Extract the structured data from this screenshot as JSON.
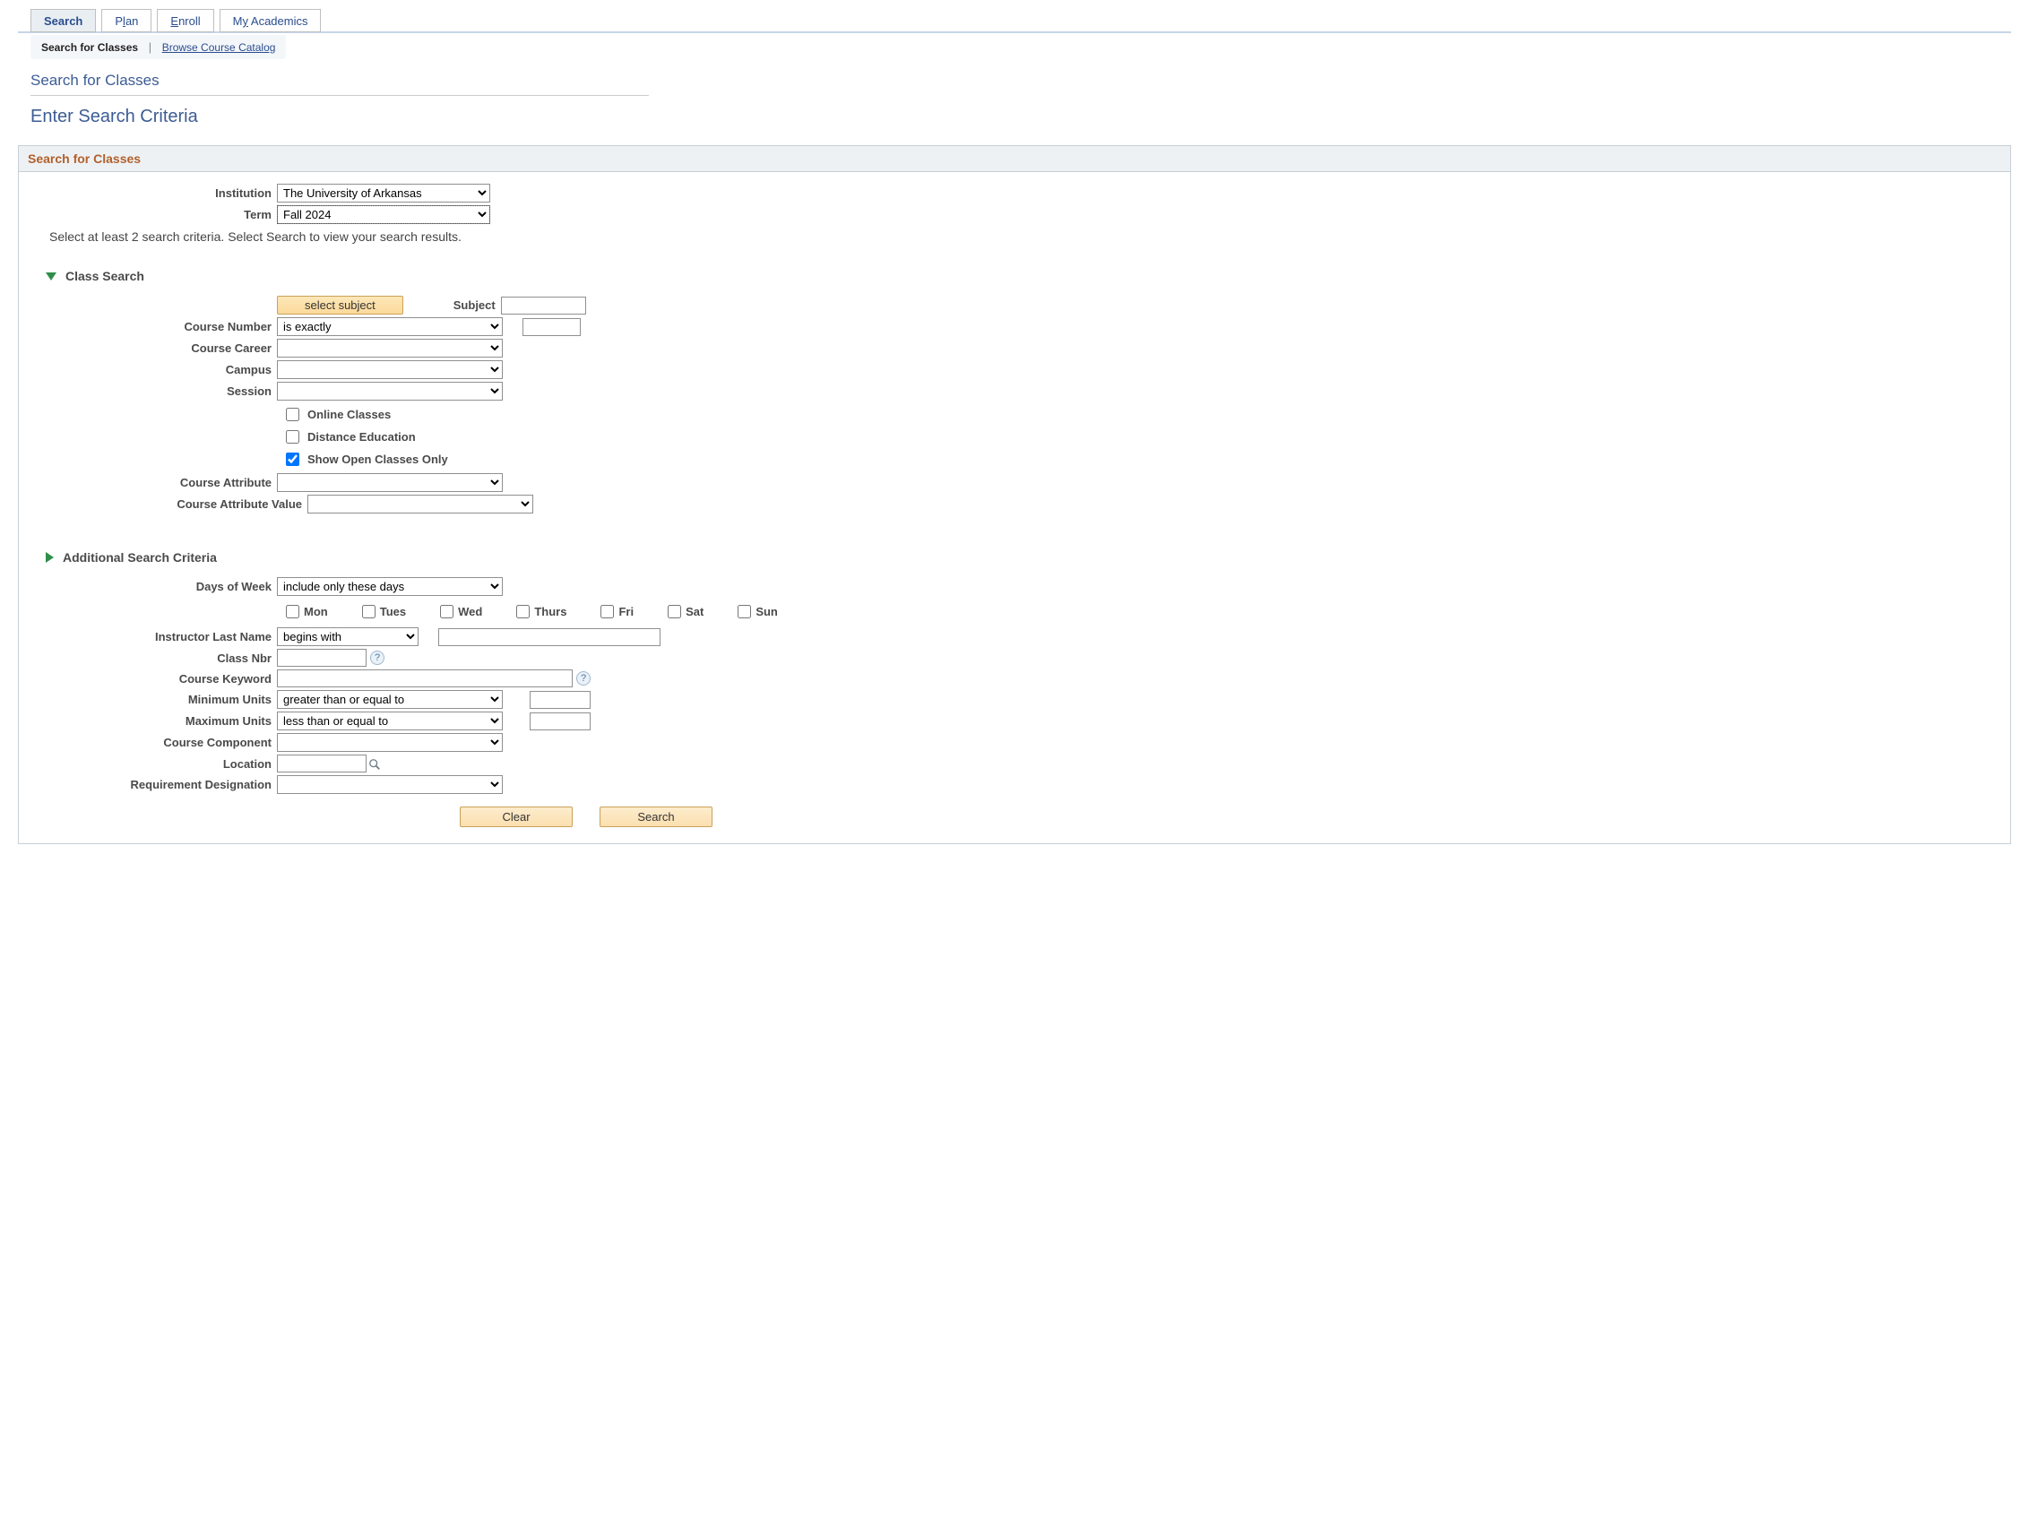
{
  "tabs": {
    "search": "Search",
    "plan_pre": "P",
    "plan_ul": "l",
    "plan_post": "an",
    "enroll_pre": "",
    "enroll_ul": "E",
    "enroll_post": "nroll",
    "myacad_pre": "M",
    "myacad_ul": "y",
    "myacad_post": " Academics"
  },
  "subtabs": {
    "search_for_classes": "Search for Classes",
    "browse": "Browse Course Catalog"
  },
  "titles": {
    "page": "Search for Classes",
    "sub": "Enter Search Criteria",
    "panel": "Search for Classes"
  },
  "labels": {
    "institution": "Institution",
    "term": "Term",
    "instructions": "Select at least 2 search criteria. Select Search to view your search results.",
    "class_search": "Class Search",
    "select_subject_btn": "select subject",
    "subject": "Subject",
    "course_number": "Course Number",
    "course_career": "Course Career",
    "campus": "Campus",
    "session": "Session",
    "online_classes": "Online Classes",
    "distance_ed": "Distance Education",
    "open_only": "Show Open Classes Only",
    "course_attr": "Course Attribute",
    "course_attr_val": "Course Attribute Value",
    "additional": "Additional Search Criteria",
    "days_of_week": "Days of Week",
    "mon": "Mon",
    "tue": "Tues",
    "wed": "Wed",
    "thu": "Thurs",
    "fri": "Fri",
    "sat": "Sat",
    "sun": "Sun",
    "instr_last": "Instructor Last Name",
    "class_nbr": "Class Nbr",
    "course_keyword": "Course Keyword",
    "min_units": "Minimum Units",
    "max_units": "Maximum Units",
    "course_comp": "Course Component",
    "location": "Location",
    "req_desig": "Requirement Designation",
    "clear": "Clear",
    "search": "Search"
  },
  "values": {
    "institution": "The University of Arkansas",
    "term": "Fall 2024",
    "course_number_op": "is exactly",
    "days_of_week_op": "include only these days",
    "instr_op": "begins with",
    "min_units_op": "greater than or equal to",
    "max_units_op": "less than or equal to"
  }
}
